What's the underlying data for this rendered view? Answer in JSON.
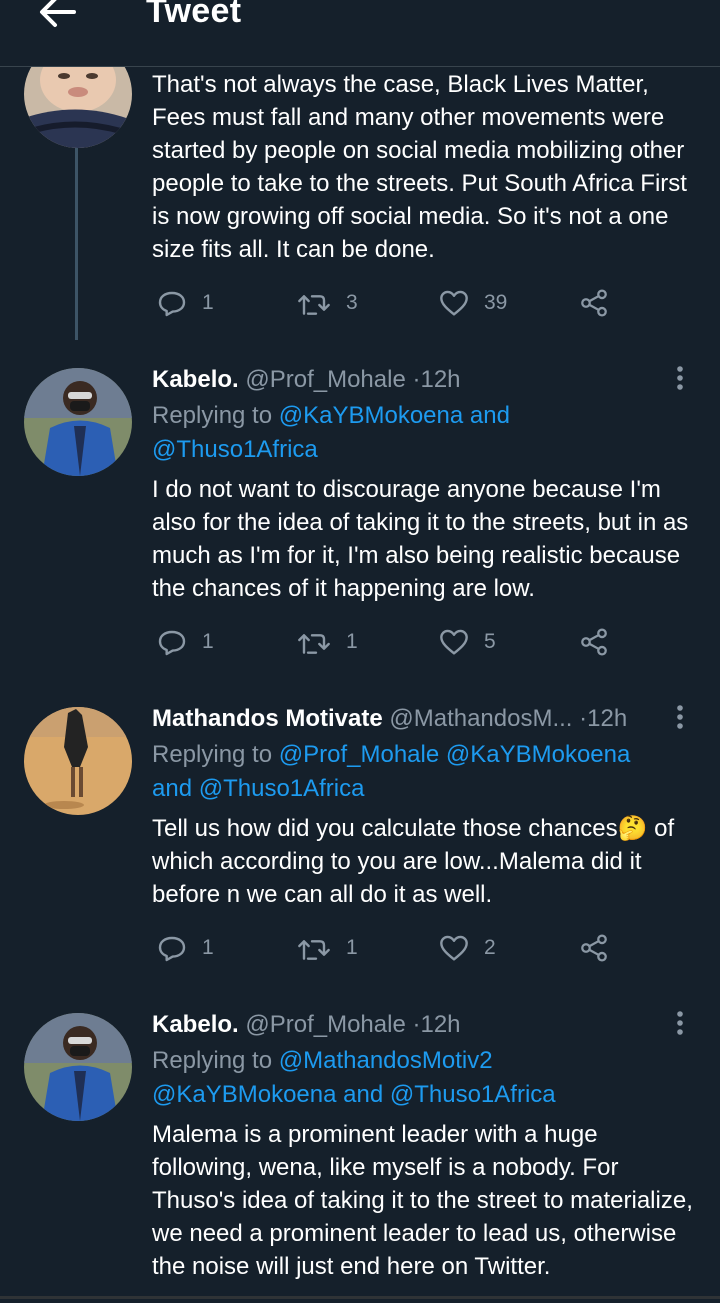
{
  "header": {
    "title": "Tweet",
    "back_icon": "arrow-left-icon"
  },
  "colors": {
    "background": "#15202b",
    "link": "#1d9bf0",
    "muted": "#8b98a5",
    "thread_line": "#3d5466"
  },
  "tweets": [
    {
      "text": "That's not always the case, Black Lives Matter, Fees must fall and many other movements were started by people on social media mobilizing other people to take to the streets. Put South Africa First is now growing off social media. So it's not a one size fits all. It can be done.",
      "replies": "1",
      "retweets": "3",
      "likes": "39"
    },
    {
      "name": "Kabelo.",
      "handle": "@Prof_Mohale",
      "sep": "·",
      "time": "12h",
      "replying_prefix": "Replying to",
      "mentions": [
        "@KaYBMokoena",
        "@Thuso1Africa"
      ],
      "joiner": "and",
      "text": "I do not want to discourage anyone because I'm also for the idea of taking it to the streets, but in as much as I'm for it, I'm also being realistic because the chances of it happening are low.",
      "replies": "1",
      "retweets": "1",
      "likes": "5"
    },
    {
      "name": "Mathandos Motivate",
      "handle": "@MathandosM...",
      "sep": "·",
      "time": "12h",
      "replying_prefix": "Replying to",
      "mentions": [
        "@Prof_Mohale",
        "@KaYBMokoena",
        "@Thuso1Africa"
      ],
      "joiner": "and",
      "text": "Tell us how did you calculate those chances🤔 of which according to you are low...Malema did it before n we can all do it as well.",
      "replies": "1",
      "retweets": "1",
      "likes": "2"
    },
    {
      "name": "Kabelo.",
      "handle": "@Prof_Mohale",
      "sep": "·",
      "time": "12h",
      "replying_prefix": "Replying to",
      "mentions": [
        "@MathandosMotiv2",
        "@KaYBMokoena",
        "@Thuso1Africa"
      ],
      "joiner": "and",
      "text": "Malema is a prominent leader with a huge following,  wena, like myself is a nobody. For Thuso's idea of taking it to the street to materialize, we need a prominent leader to lead us, otherwise the noise will just end here on Twitter."
    }
  ]
}
